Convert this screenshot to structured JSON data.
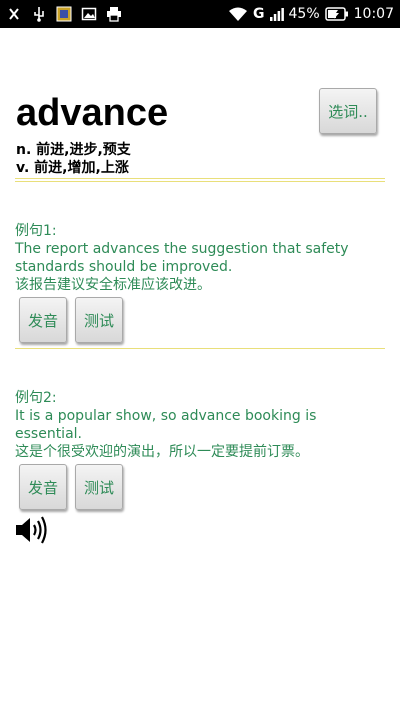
{
  "status_bar": {
    "network": "G",
    "battery_percent": "45%",
    "time": "10:07"
  },
  "word": {
    "title": "advance",
    "select_label": "选词..",
    "definitions": [
      "n. 前进,进步,预支",
      "v. 前进,增加,上涨"
    ]
  },
  "examples": [
    {
      "label": "例句1:",
      "english": " The report advances the suggestion that safety standards should be improved.",
      "chinese": "该报告建议安全标准应该改进。",
      "pronounce_label": "发音",
      "test_label": "测试"
    },
    {
      "label": "例句2:",
      "english": " It is a popular show, so advance booking is essential.",
      "chinese": "这是个很受欢迎的演出，所以一定要提前订票。",
      "pronounce_label": "发音",
      "test_label": "测试"
    }
  ],
  "colors": {
    "accent_text": "#2e8b57",
    "divider": "#e9df7a",
    "status_bar_bg": "#000000"
  },
  "icons": [
    "usb-debug-icon",
    "usb-icon",
    "notification-app-icon",
    "image-icon",
    "printer-icon",
    "wifi-icon",
    "signal-icon",
    "battery-icon",
    "speaker-icon"
  ]
}
